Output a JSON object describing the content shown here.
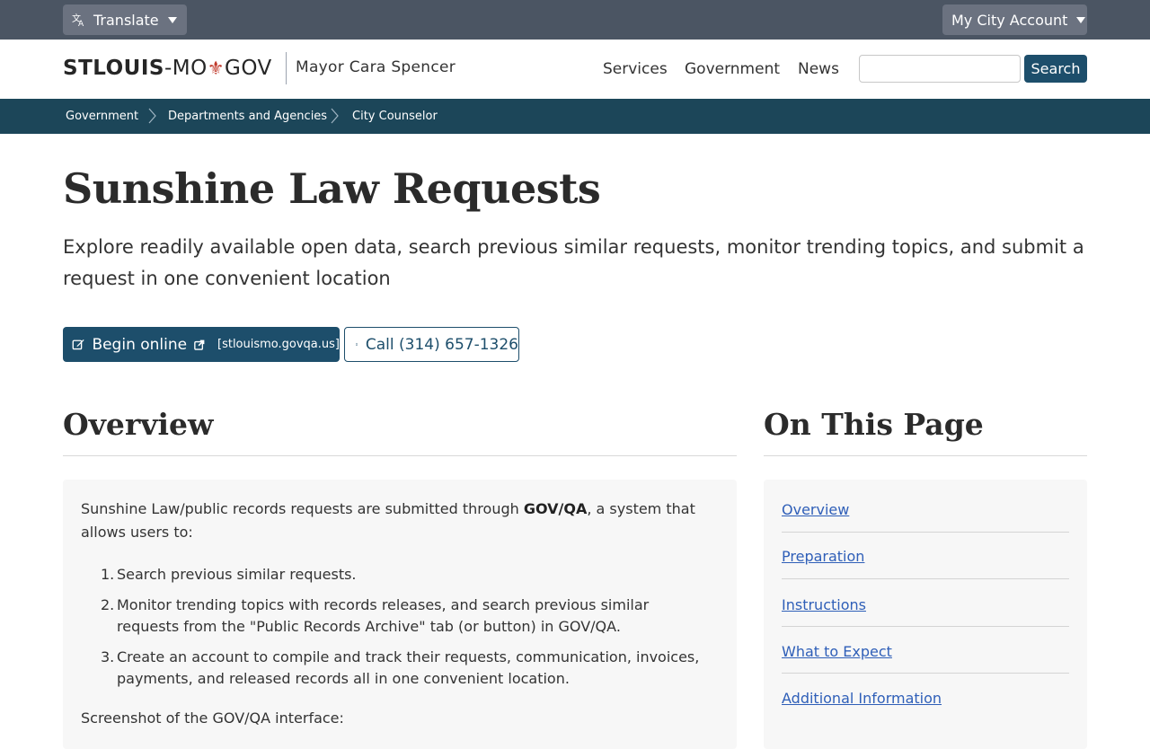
{
  "utility": {
    "translate_label": "Translate",
    "account_label": "My City Account"
  },
  "header": {
    "logo_bold": "STLOUIS",
    "logo_sep": "-MO",
    "logo_fleur": "⚜",
    "logo_end": "GOV",
    "mayor": "Mayor Cara Spencer",
    "nav": {
      "services": "Services",
      "government": "Government",
      "news": "News"
    },
    "search": {
      "value": "",
      "placeholder": "",
      "button_label": "Search"
    }
  },
  "breadcrumb": {
    "items": [
      "Government",
      "Departments and Agencies",
      "City Counselor"
    ]
  },
  "hero": {
    "title": "Sunshine Law Requests",
    "subtitle": "Explore readily available open data, search previous similar requests, monitor trending topics, and submit a request in one convenient location",
    "begin_label": "Begin online",
    "begin_domain": "[stlouismo.govqa.us]",
    "call_label": "Call (314) 657-1326"
  },
  "overview": {
    "title": "Overview",
    "intro_before": "Sunshine Law/public records requests are submitted through ",
    "intro_bold": "GOV/QA",
    "intro_after": ", a system that allows users to:",
    "steps": [
      "Search previous similar requests.",
      "Monitor trending topics with records releases, and search previous similar requests from the \"Public Records Archive\" tab (or button) in GOV/QA.",
      "Create an account to compile and track their requests, communication, invoices, payments, and released records all in one convenient location."
    ],
    "step_numbers": [
      "1.",
      "2.",
      "3."
    ],
    "trailing": "Screenshot of the GOV/QA interface:"
  },
  "on_this_page": {
    "title": "On This Page",
    "links": [
      "Overview",
      "Preparation",
      "Instructions",
      "What to Expect",
      "Additional Information"
    ]
  },
  "colors": {
    "utility_bar": "#4b5563",
    "brand_navy": "#1d4e6b",
    "breadcrumb_bg": "#1c4659",
    "link": "#2f5fb8",
    "fleur": "#c0392b"
  },
  "icons": {
    "translate": "translate-icon",
    "caret": "caret-down-icon",
    "edit": "edit-icon",
    "external": "external-link-icon",
    "phone": "mobile-phone-icon",
    "chevron": "chevron-right-icon"
  }
}
